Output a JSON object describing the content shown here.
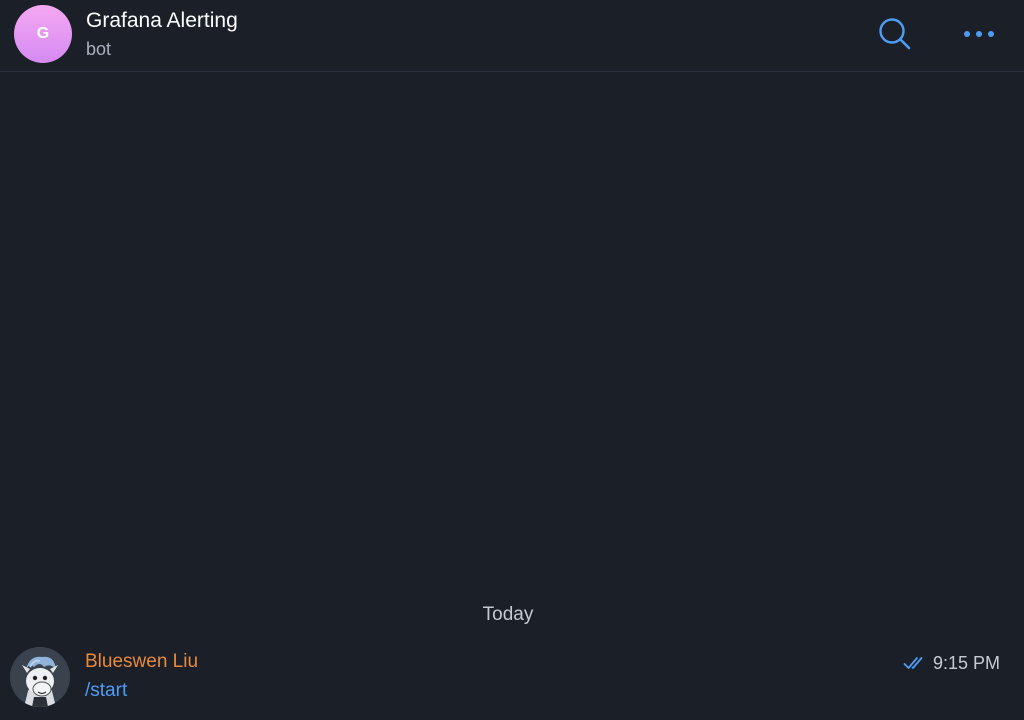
{
  "header": {
    "avatar_letter": "G",
    "title": "Grafana Alerting",
    "subtitle": "bot",
    "search_icon": "search-icon",
    "more_icon": "more-horizontal-icon"
  },
  "chat": {
    "date_divider": "Today",
    "messages": [
      {
        "author": "Blueswen Liu",
        "text": "/start",
        "time": "9:15 PM",
        "status_icon": "double-check-icon"
      }
    ]
  },
  "colors": {
    "background": "#1b1f28",
    "accent": "#4d9df5",
    "author": "#e8893c",
    "avatar_gradient_top": "#f5a8f2",
    "avatar_gradient_bottom": "#d58af3"
  }
}
